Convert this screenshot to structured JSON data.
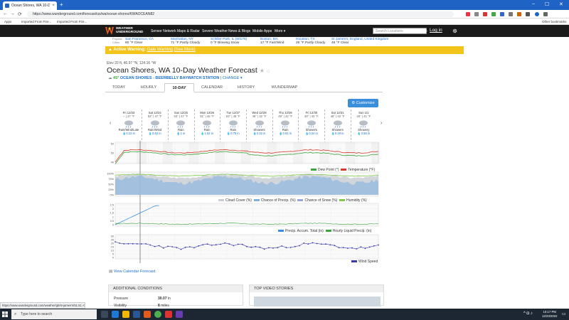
{
  "browser": {
    "tab_title": "Ocean Shores, WA 10-Day Weather Forecast",
    "new_tab": "+",
    "tab_close": "×",
    "url": "https://www.wunderground.com/forecast/us/wa/ocean-shores/KWAOCEAN82",
    "nav_back": "←",
    "nav_forward": "→",
    "nav_reload": "⟳",
    "win_min": "–",
    "win_max": "☐",
    "win_close": "✕",
    "bookmarks": [
      "Apps",
      "Imported From Fire...",
      "Imported From Fire..."
    ],
    "other_bookmarks": "Other bookmarks"
  },
  "header": {
    "logo_line1": "WEATHER",
    "logo_line2": "UNDERGROUND",
    "nav": [
      "Sensor Network",
      "Maps & Radar",
      "Severe Weather",
      "News & Blogs",
      "Mobile Apps",
      "More"
    ],
    "search_placeholder": "Search Locations",
    "login": "Log in"
  },
  "favorites": {
    "label_line1": "Popular",
    "label_line2": "Cities",
    "cities": [
      {
        "name": "San Francisco, CA",
        "cond": "60 °F Clear"
      },
      {
        "name": "Manhattan, NY",
        "cond": "71 °F Partly Cloudy"
      },
      {
        "name": "Schiller Park, IL (60176)",
        "cond": "0 °F Blowing Snow"
      },
      {
        "name": "Boston, MA",
        "cond": "17 °F Fair/Wind"
      },
      {
        "name": "Houston, TX",
        "cond": "26 °F Partly Cloudy"
      },
      {
        "name": "St James's, England, United Kingdom",
        "cond": "45 °F Clear"
      }
    ]
  },
  "warning": {
    "label": "Active Warning:",
    "type": "Gale Warning",
    "see_more": "(See More)"
  },
  "page": {
    "elevation": "Elev 20 ft, 46.97 °N, 124.16 °W",
    "title": "Ocean Shores, WA 10-Day Weather Forecast",
    "station_temp": "45°",
    "station_name": "OCEAN SHORES - BEERBELLY BAYWATCH STATION",
    "station_change": "| CHANGE",
    "tabs": [
      "TODAY",
      "HOURLY",
      "10-DAY",
      "CALENDAR",
      "HISTORY",
      "WUNDERMAP"
    ],
    "active_tab": "10-DAY",
    "customize": "Customize",
    "calendar_link": "View Calendar Forecast"
  },
  "days": [
    {
      "date": "Fri 12/23",
      "hilo": "-- | 47 °F",
      "cond": "Rain/Wind/Late",
      "precip": "0.22 in"
    },
    {
      "date": "Sat 12/24",
      "hilo": "53° | 47 °F",
      "cond": "Rain/Wind",
      "precip": "0.62 in"
    },
    {
      "date": "Sun 12/25",
      "hilo": "53° | 47 °F",
      "cond": "Rain",
      "precip": "1 in"
    },
    {
      "date": "Mon 12/26",
      "hilo": "51° | 45 °F",
      "cond": "Rain",
      "precip": "1.52 in"
    },
    {
      "date": "Tue 12/27",
      "hilo": "53° | 45 °F",
      "cond": "Rain",
      "precip": "0.75 in"
    },
    {
      "date": "Wed 12/28",
      "hilo": "49° | 42 °F",
      "cond": "Showers",
      "precip": "0.32 in"
    },
    {
      "date": "Thu 12/29",
      "hilo": "49° | 42 °F",
      "cond": "Rain",
      "precip": "0.81 in"
    },
    {
      "date": "Fri 12/30",
      "hilo": "48° | 43 °F",
      "cond": "Showers",
      "precip": "0.24 in"
    },
    {
      "date": "Sat 12/31",
      "hilo": "48° | 42 °F",
      "cond": "Showers",
      "precip": "0.29 in"
    },
    {
      "date": "Sun 1/1",
      "hilo": "46° | 41 °F",
      "cond": "Showery",
      "precip": "0.55 in"
    }
  ],
  "legends": {
    "temp": [
      "Dew Point (°)",
      "Temperature (°F)"
    ],
    "cloud": [
      "Cloud Cover (%)",
      "Chance of Precip. (%)",
      "Chance of Snow (%)",
      "Humidity (%)"
    ],
    "precip": [
      "Precip. Accum. Total (in)",
      "Hourly Liquid Precip. (in)"
    ],
    "wind": [
      "Wind Speed"
    ]
  },
  "axes": {
    "temp": [
      "60",
      "50",
      "40"
    ],
    "cloud": [
      "100%",
      "75%",
      "50%",
      "25%",
      "0%"
    ],
    "precip": [
      "2.5",
      "2",
      "1.5",
      "1",
      "0.5",
      "0"
    ],
    "wind": [
      "30",
      "25",
      "20",
      "15",
      "10",
      "5",
      "0"
    ]
  },
  "colors": {
    "temperature": "#d63a2e",
    "dewpoint": "#3aa53a",
    "cloud": "#c8cdd3",
    "precip_chance": "#7bb0e0",
    "humidity": "#7ec94a",
    "accum": "#3b8edc",
    "hourly_precip": "#3aa53a",
    "wind": "#3a3aa8"
  },
  "conditions": {
    "title": "ADDITIONAL CONDITIONS",
    "pressure_label": "Pressure",
    "pressure_value": "30.07",
    "pressure_unit": "in",
    "visibility_label": "Visibility",
    "visibility_value": "8",
    "visibility_unit": "miles"
  },
  "videos": {
    "title": "TOP VIDEO STORIES"
  },
  "status_url": "https://www.wunderground.com/weather/gb/st-james's/51.51,-0.14",
  "taskbar": {
    "search": "Type here to search",
    "time": "10:17 PM",
    "date": "12/23/2022"
  }
}
